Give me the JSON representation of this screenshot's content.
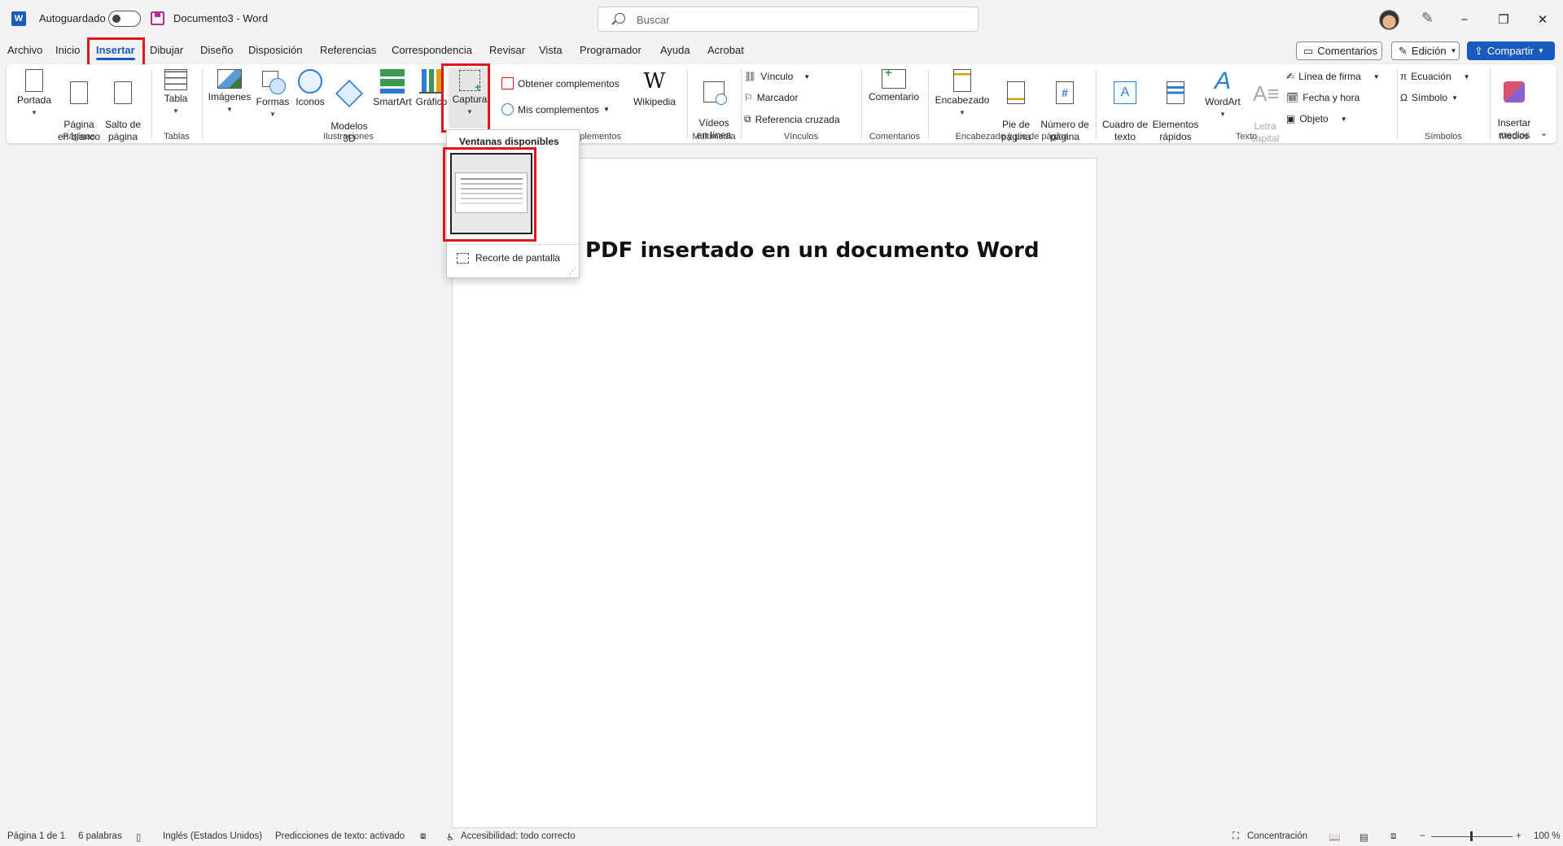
{
  "app": {
    "autosave_label": "Autoguardado",
    "doc_title": "Documento3  -  Word",
    "search_placeholder": "Buscar",
    "minimize": "−",
    "restore": "❐",
    "close": "✕"
  },
  "tabs": [
    "Archivo",
    "Inicio",
    "Insertar",
    "Dibujar",
    "Diseño",
    "Disposición",
    "Referencias",
    "Correspondencia",
    "Revisar",
    "Vista",
    "Programador",
    "Ayuda",
    "Acrobat"
  ],
  "top_buttons": {
    "comments": "Comentarios",
    "editing": "Edición",
    "share": "Compartir"
  },
  "ribbon": {
    "paginas": {
      "label": "Páginas",
      "cover": "Portada",
      "blank": "Página\nen blanco",
      "break": "Salto de\npágina"
    },
    "tablas": {
      "label": "Tablas",
      "table": "Tabla"
    },
    "ilustraciones": {
      "label": "Ilustraciones",
      "images": "Imágenes",
      "shapes": "Formas",
      "icons": "Iconos",
      "models": "Modelos\n3D",
      "smartart": "SmartArt",
      "chart": "Gráfico",
      "screenshot": "Captura"
    },
    "complementos": {
      "label": "Complementos",
      "get": "Obtener complementos",
      "mine": "Mis complementos",
      "wikipedia": "Wikipedia"
    },
    "multimedia": {
      "label": "Multimedia",
      "video": "Vídeos\nen línea"
    },
    "vinculos": {
      "label": "Vínculos",
      "link": "Vínculo",
      "bookmark": "Marcador",
      "crossref": "Referencia cruzada"
    },
    "comentarios": {
      "label": "Comentarios",
      "comment": "Comentario"
    },
    "encabezado": {
      "label": "Encabezado y pie de página",
      "header": "Encabezado",
      "footer": "Pie de\npágina",
      "pagenum": "Número de\npágina"
    },
    "texto": {
      "label": "Texto",
      "textbox": "Cuadro de\ntexto",
      "quickparts": "Elementos\nrápidos",
      "wordart": "WordArt",
      "dropcap": "Letra\ncapital",
      "signature": "Línea de firma",
      "datetime": "Fecha y hora",
      "object": "Objeto"
    },
    "simbolos": {
      "label": "Símbolos",
      "equation": "Ecuación",
      "symbol": "Símbolo"
    },
    "medios": {
      "label": "Medios",
      "insert_media": "Insertar\nmedios"
    }
  },
  "dropdown": {
    "title": "Ventanas disponibles",
    "screen_clip": "Recorte de pantalla"
  },
  "document": {
    "heading": "PDF insertado en un documento Word"
  },
  "status": {
    "page": "Página 1 de 1",
    "words": "6 palabras",
    "language": "Inglés (Estados Unidos)",
    "predictions": "Predicciones de texto: activado",
    "accessibility": "Accesibilidad: todo correcto",
    "focus": "Concentración",
    "zoom": "100 %"
  },
  "colors": {
    "accent": "#185abd",
    "highlight": "#e0161e"
  }
}
